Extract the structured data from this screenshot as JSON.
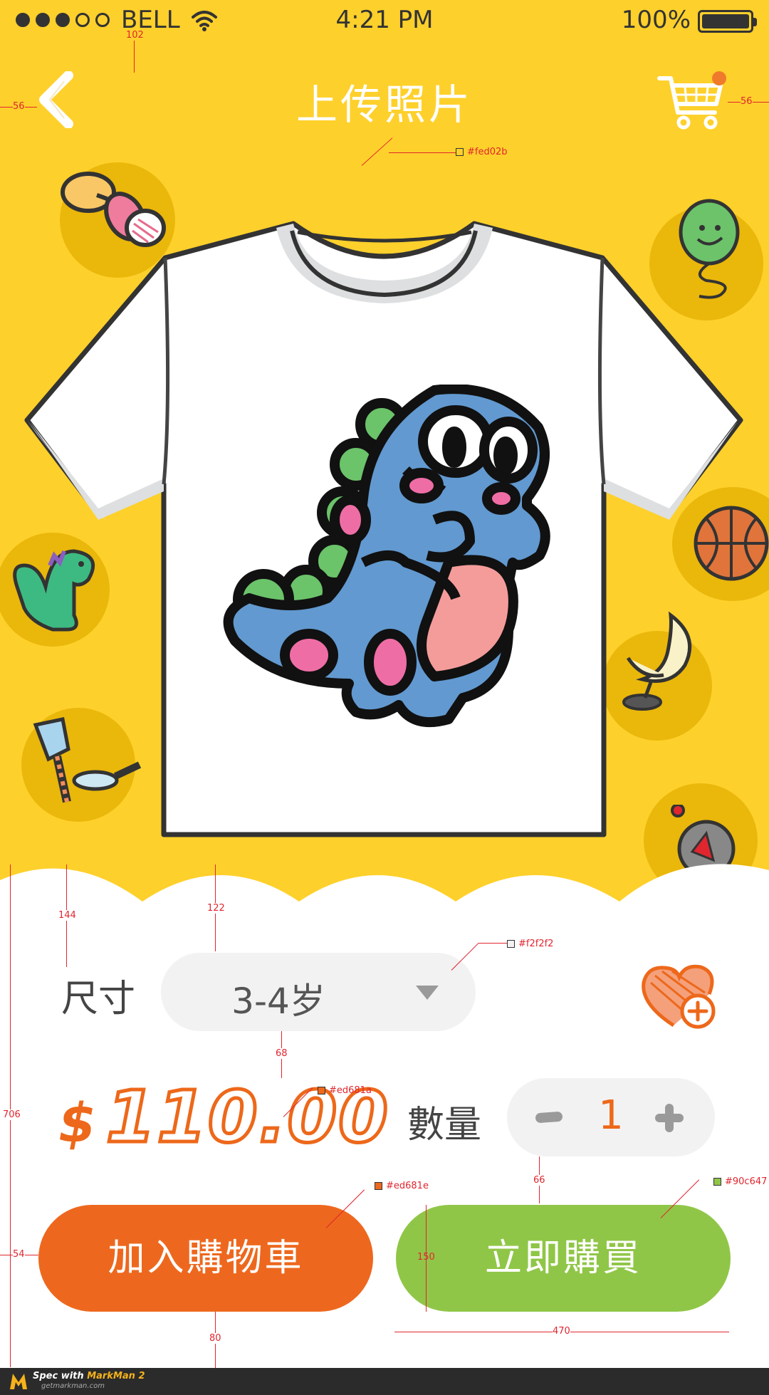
{
  "status_bar": {
    "carrier": "BELL",
    "time": "4:21 PM",
    "battery": "100%"
  },
  "header": {
    "title": "上传照片",
    "back_icon": "chevron-left-icon",
    "cart_icon": "shopping-cart-icon",
    "cart_badge_color": "#f07a2b"
  },
  "product": {
    "image": "t-shirt-with-blue-dinosaur",
    "decorations": [
      "pacifier-icon",
      "balloon-icon",
      "dinosaur-icon",
      "basketball-icon",
      "moon-icon",
      "shovel-icon",
      "alarm-clock-icon"
    ]
  },
  "size": {
    "label": "尺寸",
    "value": "3-4岁"
  },
  "favorite_icon": "heart-add-icon",
  "price": {
    "currency": "$",
    "amount": "110.00"
  },
  "quantity": {
    "label": "數量",
    "value": "1"
  },
  "buttons": {
    "add_to_cart": "加入購物車",
    "buy_now": "立即購買"
  },
  "spec": {
    "colors": {
      "header": "#fed02b",
      "select_bg": "#f2f2f2",
      "price": "#ed681a",
      "add_to_cart": "#ed681e",
      "buy_now": "#90c647"
    },
    "labels": {
      "top_102": "102",
      "left_56": "56",
      "right_56": "56",
      "c_header": "#fed02b",
      "d_144": "144",
      "d_122": "122",
      "c_select": "#f2f2f2",
      "d_706": "706",
      "d_68": "68",
      "c_price": "#ed681a",
      "d_66": "66",
      "c_cart": "#ed681e",
      "c_buy": "#90c647",
      "d_54": "54",
      "d_150": "150",
      "d_80": "80",
      "d_470": "470"
    }
  },
  "footer": {
    "brand_prefix": "Spec with ",
    "brand_name": "MarkMan 2",
    "site": "getmarkman.com"
  }
}
